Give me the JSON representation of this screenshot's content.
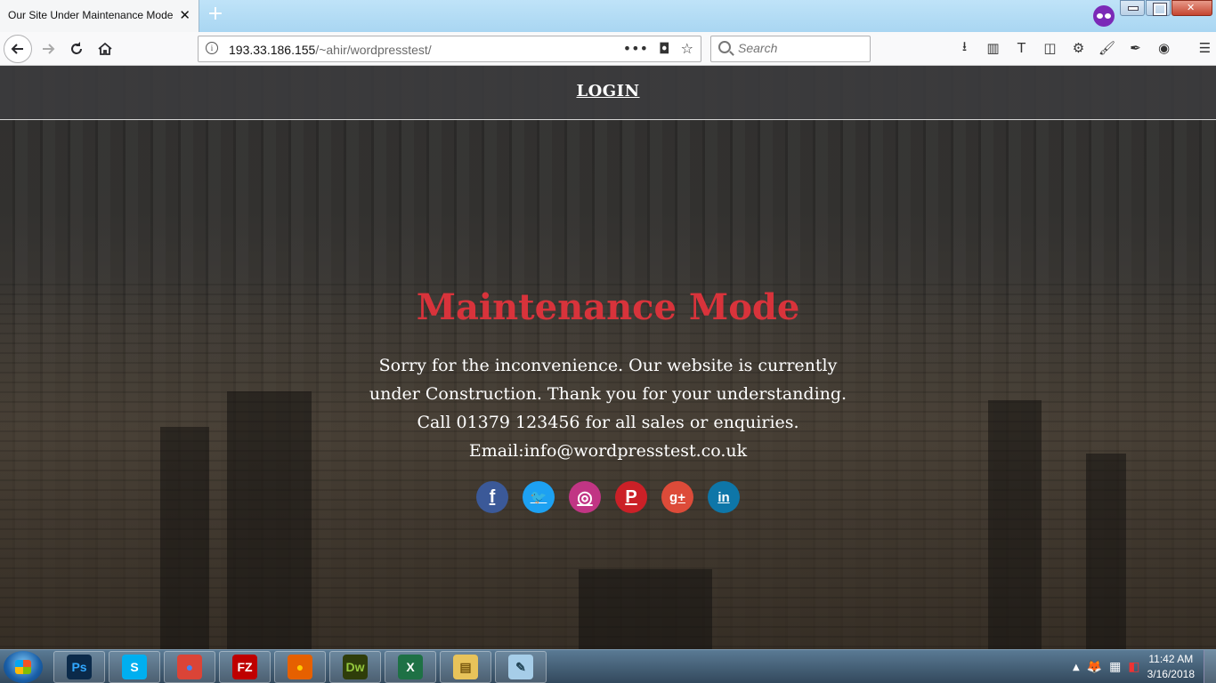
{
  "browser": {
    "tab_title": "Our Site Under Maintenance Mode",
    "tab_close": "✕",
    "new_tab": "+",
    "url_host": "193.33.186.155",
    "url_path": "/~ahir/wordpresstest/",
    "search_placeholder": "Search",
    "url_actions": [
      "•••",
      "◘",
      "☆"
    ]
  },
  "page": {
    "login_label": "LOGIN",
    "title": "Maintenance Mode",
    "message": "Sorry for the inconvenience. Our website is currently under Construction. Thank you for your understanding. Call 01379 123456 for all sales or enquiries.",
    "email": "Email:info@wordpresstest.co.uk",
    "title_color": "#d8333b",
    "socials": [
      {
        "name": "facebook",
        "glyph": "f",
        "color": "#3b5998"
      },
      {
        "name": "twitter",
        "glyph": "🐦",
        "color": "#1da1f2"
      },
      {
        "name": "instagram",
        "glyph": "◎",
        "color": "#c13584"
      },
      {
        "name": "pinterest",
        "glyph": "P",
        "color": "#cb2027"
      },
      {
        "name": "google-plus",
        "glyph": "g+",
        "color": "#dd4b39"
      },
      {
        "name": "linkedin",
        "glyph": "in",
        "color": "#0e76a8"
      }
    ]
  },
  "taskbar": {
    "apps": [
      {
        "name": "photoshop",
        "label": "Ps",
        "color": "#0b2a4a",
        "fg": "#31a8ff"
      },
      {
        "name": "skype",
        "label": "S",
        "color": "#00aff0",
        "fg": "#fff"
      },
      {
        "name": "chrome",
        "label": "●",
        "color": "#db4437",
        "fg": "#4285f4"
      },
      {
        "name": "filezilla",
        "label": "FZ",
        "color": "#bf0000",
        "fg": "#fff"
      },
      {
        "name": "firefox",
        "label": "●",
        "color": "#e66000",
        "fg": "#ffcb00"
      },
      {
        "name": "dreamweaver",
        "label": "Dw",
        "color": "#2f3d0a",
        "fg": "#94c83d"
      },
      {
        "name": "excel",
        "label": "X",
        "color": "#1e7145",
        "fg": "#fff"
      },
      {
        "name": "explorer",
        "label": "▤",
        "color": "#e8c35a",
        "fg": "#7a5a10"
      },
      {
        "name": "notepad",
        "label": "✎",
        "color": "#a6cde8",
        "fg": "#245"
      }
    ],
    "time": "11:42 AM",
    "date": "3/16/2018"
  }
}
